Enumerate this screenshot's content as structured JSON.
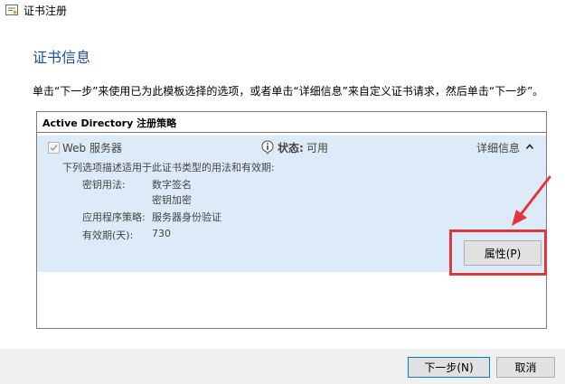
{
  "window": {
    "title": "证书注册"
  },
  "page": {
    "heading": "证书信息",
    "instruction": "单击“下一步”来使用已为此模板选择的选项，或者单击“详细信息”来自定义证书请求，然后单击“下一步”。"
  },
  "policy": {
    "header": "Active Directory 注册策略",
    "template": {
      "checked": true,
      "name": "Web 服务器",
      "status_label": "状态:",
      "status_value": "可用",
      "details_label": "详细信息",
      "description": "下列选项描述适用于此证书类型的用法和有效期:",
      "key_usage_label": "密钥用法:",
      "key_usage_values": [
        "数字签名",
        "密钥加密"
      ],
      "app_policy_label": "应用程序策略:",
      "app_policy_value": "服务器身份验证",
      "validity_label": "有效期(天):",
      "validity_value": "730",
      "properties_button": "属性(P)"
    }
  },
  "footer": {
    "next_button": "下一步(N)",
    "cancel_button": "取消"
  },
  "colors": {
    "heading": "#1f4e9c",
    "panel_bg": "#ddeaf7",
    "annotation_red": "#e0363c",
    "footer_bg": "#f0f0f0"
  }
}
